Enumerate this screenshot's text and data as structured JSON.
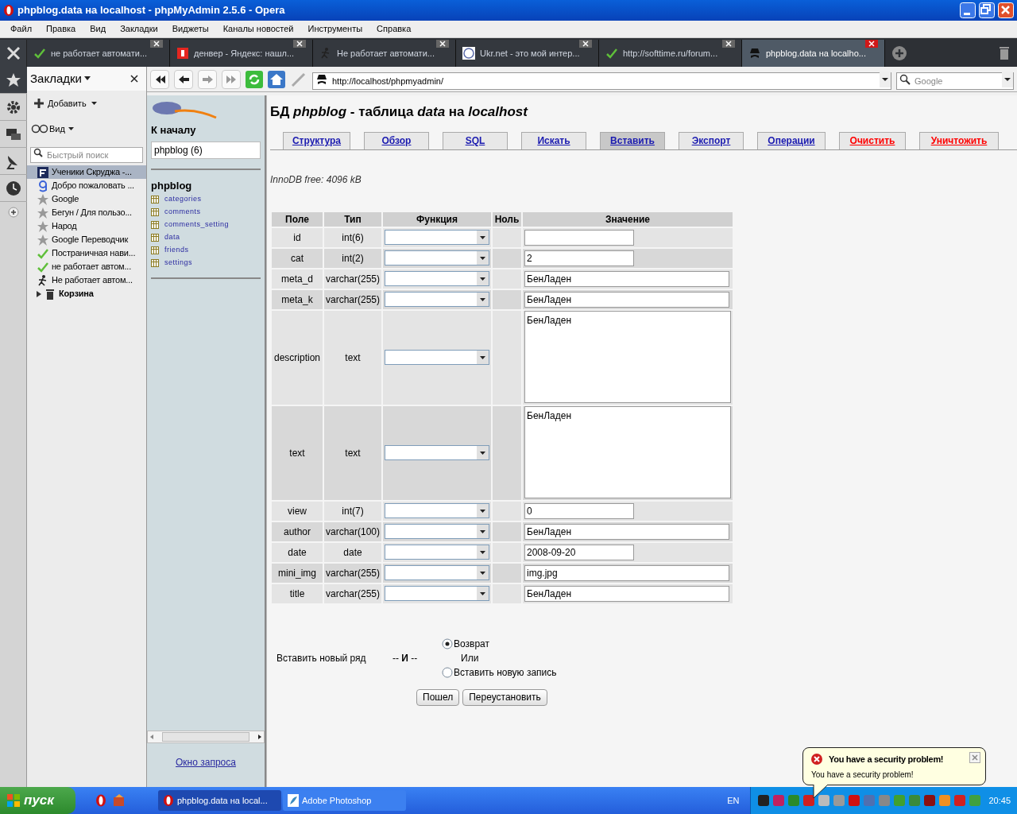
{
  "window": {
    "title": "phpblog.data на localhost - phpMyAdmin 2.5.6 - Opera"
  },
  "menu": [
    "Файл",
    "Правка",
    "Вид",
    "Закладки",
    "Виджеты",
    "Каналы новостей",
    "Инструменты",
    "Справка"
  ],
  "browser_tabs": [
    {
      "title": "не работает автомати...",
      "kind": "check",
      "selected": false
    },
    {
      "title": "денвер - Яндекс: нашл...",
      "kind": "logo",
      "selected": false
    },
    {
      "title": "Не работает автомати...",
      "kind": "runner",
      "selected": false
    },
    {
      "title": "Ukr.net - это мой интер...",
      "kind": "globe",
      "selected": false
    },
    {
      "title": "http://softtime.ru/forum...",
      "kind": "check",
      "selected": false
    },
    {
      "title": "phpblog.data на localho...",
      "kind": "spy",
      "selected": true
    }
  ],
  "bookmarks_panel": {
    "title": "Закладки",
    "add": "Добавить",
    "view": "Вид",
    "search_placeholder": "Быстрый поиск",
    "items": [
      {
        "label": "Ученики Скруджа -...",
        "kind": "f",
        "selected": true
      },
      {
        "label": "Добро пожаловать ...",
        "kind": "g",
        "selected": false
      },
      {
        "label": "Google",
        "kind": "star",
        "selected": false
      },
      {
        "label": "Бегун / Для пользо...",
        "kind": "star",
        "selected": false
      },
      {
        "label": "Народ",
        "kind": "star",
        "selected": false
      },
      {
        "label": "Google Переводчик",
        "kind": "star",
        "selected": false
      },
      {
        "label": "Постраничная нави...",
        "kind": "check",
        "selected": false
      },
      {
        "label": "не работает автом...",
        "kind": "check",
        "selected": false
      },
      {
        "label": "Не работает автом...",
        "kind": "runner",
        "selected": false
      },
      {
        "label": "Корзина",
        "kind": "folder",
        "selected": false
      }
    ]
  },
  "address_bar": {
    "url": "http://localhost/phpmyadmin/",
    "search_placeholder": "Google"
  },
  "left_frame": {
    "home": "К началу",
    "db_select": "phpblog (6)",
    "db_name": "phpblog",
    "tables": [
      "categories",
      "comments",
      "comments_setting",
      "data",
      "friends",
      "settings"
    ],
    "query_window": "Окно запроса"
  },
  "main": {
    "heading": "БД *phpblog* - таблица *data* на *localhost*",
    "tabs": [
      {
        "label": "Структура",
        "danger": false,
        "selected": false
      },
      {
        "label": "Обзор",
        "danger": false,
        "selected": false
      },
      {
        "label": "SQL",
        "danger": false,
        "selected": false
      },
      {
        "label": "Искать",
        "danger": false,
        "selected": false
      },
      {
        "label": "Вставить",
        "danger": false,
        "selected": true
      },
      {
        "label": "Экспорт",
        "danger": false,
        "selected": false
      },
      {
        "label": "Операции",
        "danger": false,
        "selected": false
      },
      {
        "label": "Очистить",
        "danger": true,
        "selected": false
      },
      {
        "label": "Уничтожить",
        "danger": true,
        "selected": false
      }
    ],
    "innodb": "InnoDB free: 4096 kB",
    "columns": [
      "Поле",
      "Тип",
      "Функция",
      "Ноль",
      "Значение"
    ],
    "rows": [
      {
        "field": "id",
        "type": "int(6)",
        "kind": "short",
        "value": ""
      },
      {
        "field": "cat",
        "type": "int(2)",
        "kind": "short",
        "value": "2"
      },
      {
        "field": "meta_d",
        "type": "varchar(255)",
        "kind": "long",
        "value": "БенЛаден"
      },
      {
        "field": "meta_k",
        "type": "varchar(255)",
        "kind": "long",
        "value": "БенЛаден"
      },
      {
        "field": "description",
        "type": "text",
        "kind": "textarea",
        "value": "БенЛаден"
      },
      {
        "field": "text",
        "type": "text",
        "kind": "textarea",
        "value": "БенЛаден"
      },
      {
        "field": "view",
        "type": "int(7)",
        "kind": "short",
        "value": "0"
      },
      {
        "field": "author",
        "type": "varchar(100)",
        "kind": "long",
        "value": "БенЛаден"
      },
      {
        "field": "date",
        "type": "date",
        "kind": "short",
        "value": "2008-09-20"
      },
      {
        "field": "mini_img",
        "type": "varchar(255)",
        "kind": "long",
        "value": "img.jpg"
      },
      {
        "field": "title",
        "type": "varchar(255)",
        "kind": "long",
        "value": "БенЛаден"
      }
    ],
    "insert_label": "Вставить новый ряд",
    "and_label": "-- **И** --",
    "options": [
      {
        "label": "Возврат",
        "selected": true
      },
      {
        "label": "Вставить новую запись",
        "selected": false
      }
    ],
    "or_label": "Или",
    "buttons": [
      "Пошел",
      "Переустановить"
    ]
  },
  "taskbar": {
    "start": "пуск",
    "tasks": [
      {
        "label": "phpblog.data на local...",
        "selected": true
      },
      {
        "label": "Adobe Photoshop",
        "selected": false
      }
    ],
    "language": "EN",
    "clock": "20:45"
  },
  "balloon": {
    "title": "You have a security problem!",
    "text": "You have a security problem!"
  }
}
